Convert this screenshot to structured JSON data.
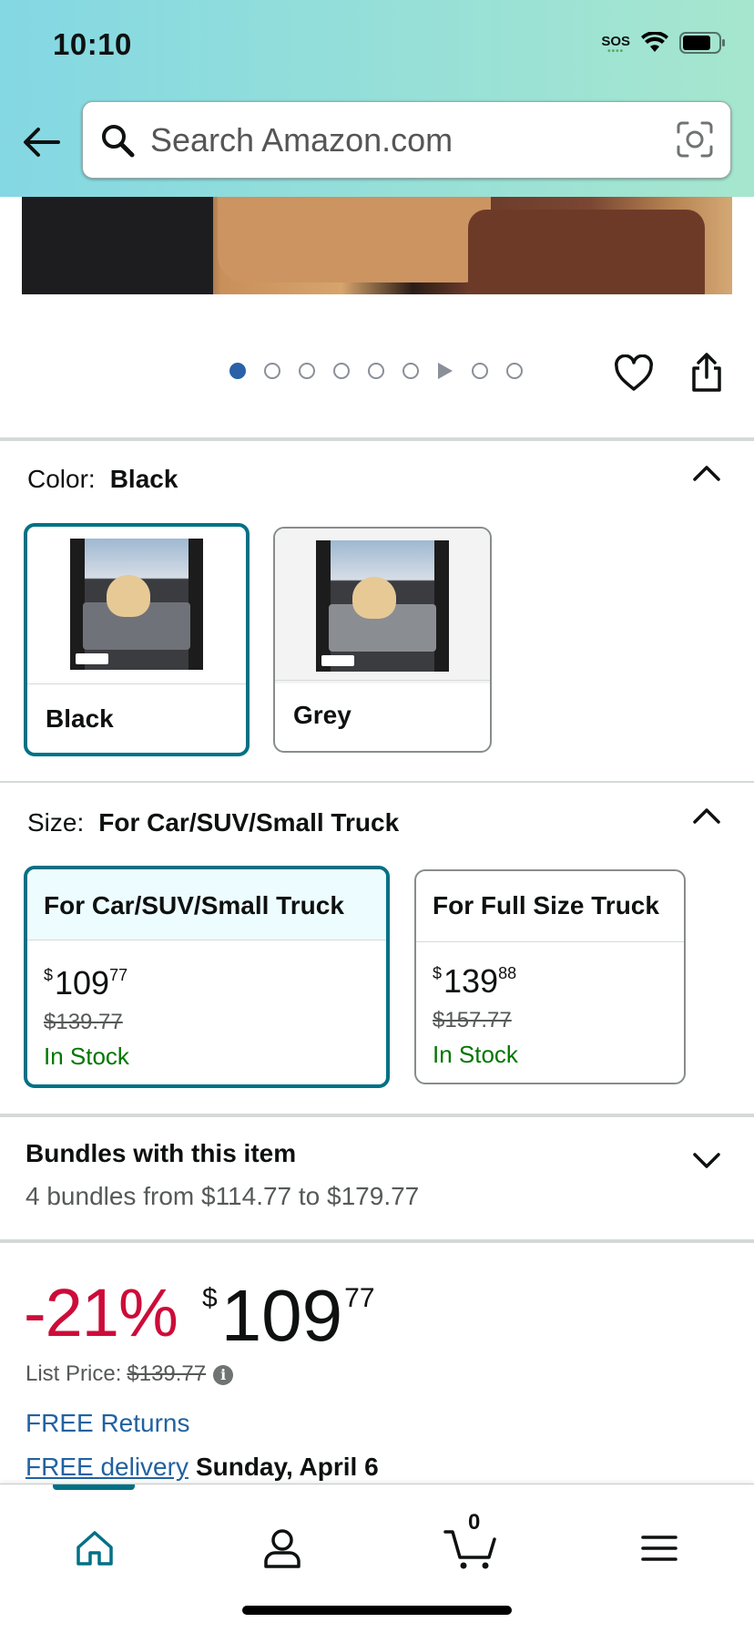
{
  "status_bar": {
    "time": "10:10",
    "sos": "SOS"
  },
  "search": {
    "placeholder": "Search Amazon.com"
  },
  "carousel": {
    "total_dots": 9,
    "active_index": 0
  },
  "color_section": {
    "label": "Color:",
    "selected": "Black",
    "options": [
      {
        "name": "Black",
        "selected": true
      },
      {
        "name": "Grey",
        "selected": false
      }
    ]
  },
  "size_section": {
    "label": "Size:",
    "selected": "For Car/SUV/Small Truck",
    "options": [
      {
        "name": "For Car/SUV/Small Truck",
        "currency": "$",
        "whole": "109",
        "fraction": "77",
        "was": "$139.77",
        "stock": "In Stock",
        "selected": true
      },
      {
        "name": "For Full Size Truck",
        "currency": "$",
        "whole": "139",
        "fraction": "88",
        "was": "$157.77",
        "stock": "In Stock",
        "selected": false
      }
    ]
  },
  "bundles": {
    "title": "Bundles with this item",
    "subtitle": "4 bundles from $114.77 to $179.77"
  },
  "price_block": {
    "discount": "-21%",
    "currency": "$",
    "whole": "109",
    "fraction": "77",
    "list_price_label": "List Price:",
    "list_price": "$139.77",
    "info": "i",
    "free_returns": "FREE Returns",
    "free_delivery_link": "FREE delivery",
    "delivery_date": "Sunday, April 6"
  },
  "bottom_nav": {
    "cart_count": "0"
  },
  "colors": {
    "accent": "#007185",
    "discount": "#cc0c39",
    "link": "#2162a1",
    "in_stock": "#007600"
  }
}
